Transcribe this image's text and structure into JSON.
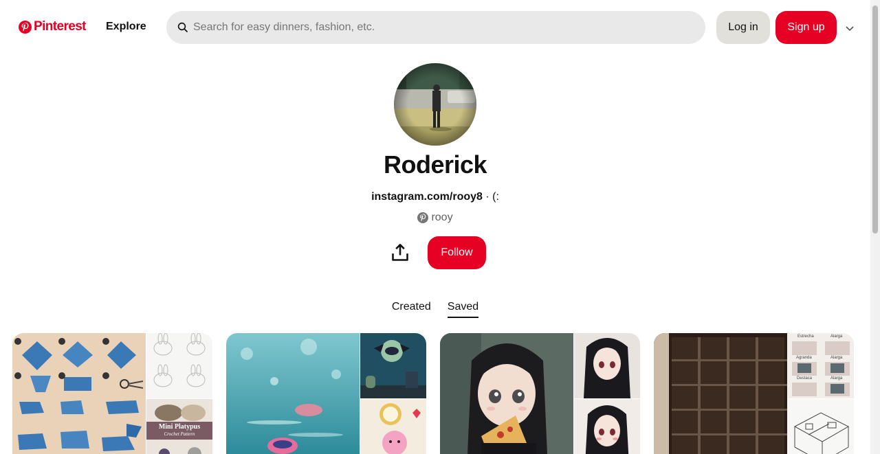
{
  "header": {
    "logo_text": "Pinterest",
    "explore_label": "Explore",
    "search_placeholder": "Search for easy dinners, fashion, etc.",
    "login_label": "Log in",
    "signup_label": "Sign up"
  },
  "profile": {
    "name": "Roderick",
    "bio_link": "instagram.com/rooy8",
    "bio_suffix": " · (:",
    "handle": "rooy",
    "follow_label": "Follow"
  },
  "tabs": [
    {
      "label": "Created",
      "active": false
    },
    {
      "label": "Saved",
      "active": true
    }
  ],
  "boards": [
    {
      "thumb_text": "Mini Platypus",
      "thumb_subtext": "Crochet Pattern"
    },
    {},
    {},
    {
      "labels": [
        "Estrecha",
        "Alarga",
        "Agranda",
        "Alarga",
        "Destaca",
        "Alarga"
      ]
    }
  ],
  "colors": {
    "brand": "#e60023",
    "search_bg": "#e9e9e9",
    "login_bg": "#e2e0db"
  },
  "icons": [
    "pinterest-logo-icon",
    "search-icon",
    "chevron-down-icon",
    "share-icon",
    "pinterest-mini-icon"
  ]
}
